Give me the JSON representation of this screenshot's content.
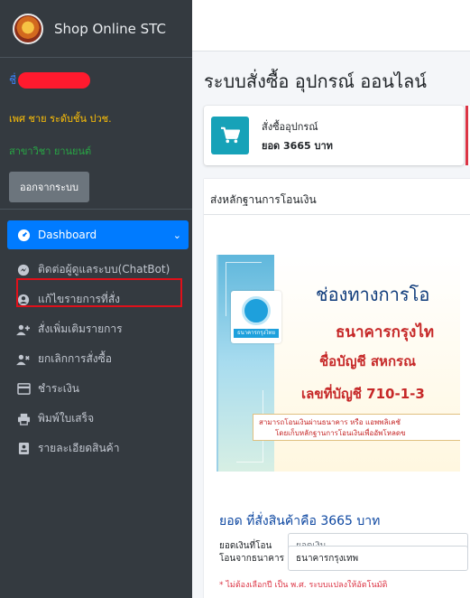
{
  "brand": {
    "title": "Shop Online STC"
  },
  "user": {
    "name_prefix": "ชื่",
    "role": "เพศ ชาย ระดับชั้น ปวช.",
    "department": "สาขาวิชา ยานยนต์",
    "logout_label": "ออกจากระบบ"
  },
  "nav": {
    "items": [
      {
        "label": "Dashboard",
        "icon": "tachometer-icon"
      },
      {
        "label": "ติดต่อผู้ดูแลระบบ(ChatBot)",
        "icon": "messenger-icon"
      },
      {
        "label": "แก้ไขรายการที่สั่ง",
        "icon": "user-circle-icon"
      },
      {
        "label": "สั่งเพิ่มเติมรายการ",
        "icon": "user-plus-icon"
      },
      {
        "label": "ยกเลิกการสั่งซื้อ",
        "icon": "user-times-icon"
      },
      {
        "label": "ชำระเงิน",
        "icon": "credit-card-icon"
      },
      {
        "label": "พิมพ์ใบเสร็จ",
        "icon": "printer-icon"
      },
      {
        "label": "รายละเอียดสินค้า",
        "icon": "id-card-icon"
      }
    ]
  },
  "main": {
    "title": "ระบบสั่งซื้อ อุปกรณ์ ออนไลน์",
    "info": {
      "label": "สั่งซื้ออุปกรณ์",
      "value": "ยอด 3665 บาท"
    },
    "card_header": "ส่งหลักฐานการโอนเงิน",
    "banner": {
      "line1": "ช่องทางการโอ",
      "line2": "ธนาคารกรุงไท",
      "line3": "ชื่อบัญชี  สหกรณ",
      "line4": "เลขที่บัญชี 710-1-3",
      "note1": "สามารถโอนเงินผ่านธนาคาร หรือ แอพพลิเคชั",
      "note2": "โดยเก็บหลักฐานการโอนเงินเพื่ออัพโหลดข",
      "logo_text": "ธนาคารกรุงไทย"
    },
    "order_total": "ยอด ที่สั่งสินค้าคือ 3665 บาท",
    "transfer_amount": {
      "label": "ยอดเงินที่โอน",
      "placeholder": "ยอดเงิน"
    },
    "from_bank": {
      "label": "โอนจากธนาคาร",
      "value": "ธนาคารกรุงเทพ"
    },
    "warning": "* ไม่ต้องเลือกปี เป็น พ.ศ. ระบบแปลงให้อัตโนมัติ"
  },
  "colors": {
    "sidebar": "#343a40",
    "active": "#007bff",
    "info_icon": "#17a2b8",
    "highlight": "#e0101a"
  }
}
